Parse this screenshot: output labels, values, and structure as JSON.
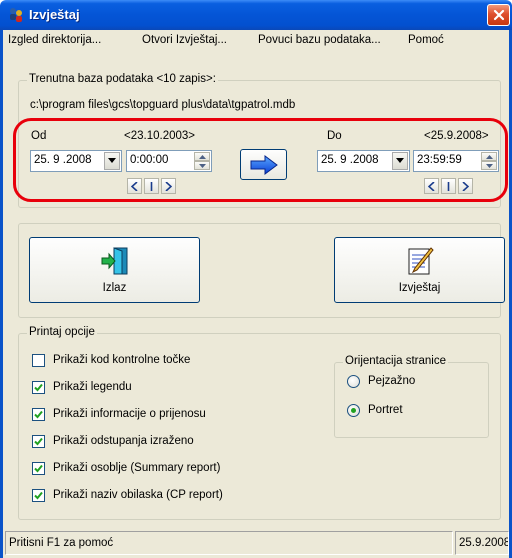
{
  "window": {
    "title": "Izvještaj",
    "icon": "app-users-icon"
  },
  "menu": {
    "items": [
      "Izgled direktorija...",
      "Otvori Izvještaj...",
      "Povuci bazu podataka...",
      "Pomoć"
    ]
  },
  "database": {
    "group_title": "Trenutna baza podataka <10 zapis>:",
    "path": "c:\\program files\\gcs\\topguard plus\\data\\tgpatrol.mdb"
  },
  "range": {
    "from_label": "Od",
    "from_min": "<23.10.2003>",
    "from_date": "25. 9 .2008",
    "from_time": "0:00:00",
    "to_label": "Do",
    "to_max": "<25.9.2008>",
    "to_date": "25. 9 .2008",
    "to_time": "23:59:59",
    "nav_left": "<",
    "nav_mid": "I",
    "nav_right": ">"
  },
  "buttons": {
    "exit_label": "Izlaz",
    "report_label": "Izvještaj"
  },
  "print_options": {
    "group_title": "Printaj opcije",
    "items": [
      {
        "label": "Prikaži kod kontrolne točke",
        "checked": false
      },
      {
        "label": "Prikaži legendu",
        "checked": true
      },
      {
        "label": "Prikaži informacije o prijenosu",
        "checked": true
      },
      {
        "label": "Prikaži odstupanja izraženo",
        "checked": true
      },
      {
        "label": "Prikaži osoblje (Summary report)",
        "checked": true
      },
      {
        "label": "Prikaži naziv obilaska (CP report)",
        "checked": true
      }
    ]
  },
  "orientation": {
    "group_title": "Orijentacija stranice",
    "landscape": "Pejzažno",
    "portrait": "Portret",
    "selected": "Portret"
  },
  "status": {
    "help": "Pritisni F1 za pomoć",
    "date": "25.9.2008"
  },
  "colors": {
    "titlebar": "#0455d6",
    "highlight": "#e8000b",
    "window_bg": "#ece9d8"
  }
}
